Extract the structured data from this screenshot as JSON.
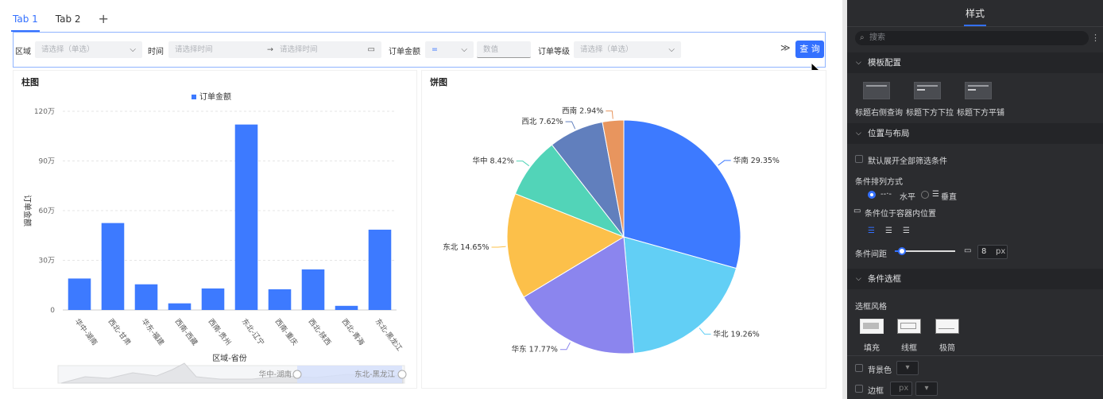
{
  "tabs": [
    {
      "label": "Tab 1",
      "active": true
    },
    {
      "label": "Tab 2",
      "active": false
    }
  ],
  "add_tab_label": "+",
  "filter": {
    "region_label": "区域",
    "region_placeholder": "请选择（单选）",
    "time_label": "时间",
    "time_start_placeholder": "请选择时间",
    "time_end_placeholder": "请选择时间",
    "amount_label": "订单金额",
    "amount_operator": "=",
    "amount_placeholder": "数值",
    "level_label": "订单等级",
    "level_placeholder": "请选择（单选）",
    "query_label": "查 询"
  },
  "bar_panel": {
    "title": "柱图"
  },
  "pie_panel": {
    "title": "饼图"
  },
  "chart_data": [
    {
      "type": "bar",
      "legend": [
        "订单金额"
      ],
      "legend_position": "top-center",
      "ylabel": "订单金额",
      "xlabel": "区域-省份",
      "ylim": [
        0,
        1200000
      ],
      "ytick_labels": [
        "0",
        "30万",
        "60万",
        "90万",
        "120万"
      ],
      "categories": [
        "华中-湖南",
        "西北-甘肃",
        "华东-福建",
        "西南-西藏",
        "西南-贵州",
        "东北-辽宁",
        "西南-重庆",
        "西北-陕西",
        "西北-青海",
        "东北-黑龙江"
      ],
      "values": [
        190000,
        525000,
        155000,
        40000,
        130000,
        1120000,
        125000,
        245000,
        25000,
        485000
      ],
      "color": "#3d7aff",
      "datazoom": {
        "start_label": "华中-湖南",
        "end_label": "东北-黑龙江"
      }
    },
    {
      "type": "pie",
      "slices": [
        {
          "label": "华南 29.35%",
          "value": 29.35,
          "color": "#3d7aff"
        },
        {
          "label": "华北 19.26%",
          "value": 19.26,
          "color": "#62cff5"
        },
        {
          "label": "华东 17.77%",
          "value": 17.77,
          "color": "#8b85ee"
        },
        {
          "label": "东北 14.65%",
          "value": 14.65,
          "color": "#fcc04a"
        },
        {
          "label": "华中 8.42%",
          "value": 8.42,
          "color": "#52d4b8"
        },
        {
          "label": "西北 7.62%",
          "value": 7.62,
          "color": "#617fbd"
        },
        {
          "label": "西南 2.94%",
          "value": 2.94,
          "color": "#e8955e"
        }
      ]
    }
  ],
  "side": {
    "title": "样式",
    "search_placeholder": "搜索",
    "sec_template": "模板配置",
    "templates": [
      "标题右侧查询",
      "标题下方下拉",
      "标题下方平铺"
    ],
    "sec_layout": "位置与布局",
    "expand_all": "默认展开全部筛选条件",
    "arrange_label": "条件排列方式",
    "arrange_horizontal": "水平",
    "arrange_vertical": "垂直",
    "position_label": "条件位于容器内位置",
    "spacing_label": "条件间距",
    "spacing_value": "8",
    "spacing_unit": "px",
    "sec_box": "条件选框",
    "box_style_label": "选框风格",
    "box_styles": [
      "填充",
      "线框",
      "极简"
    ],
    "bg_color_label": "背景色",
    "border_label": "边框",
    "border_unit": "px"
  }
}
